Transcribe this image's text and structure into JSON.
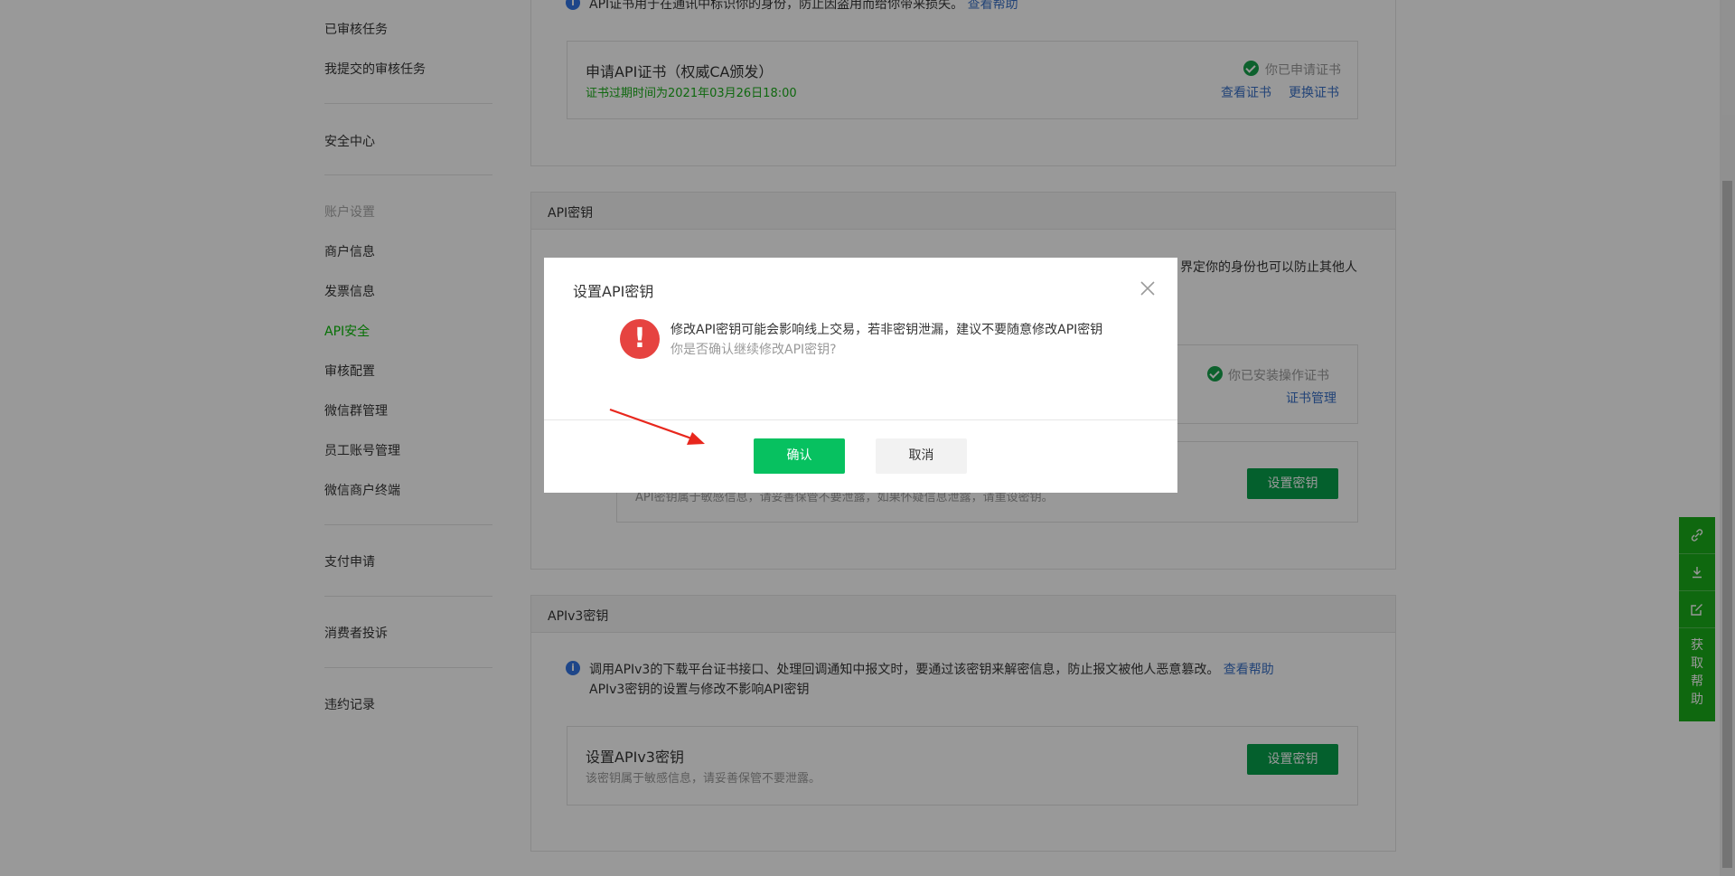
{
  "sidebar": {
    "items": [
      {
        "label": "已审核任务"
      },
      {
        "label": "我提交的审核任务"
      },
      {
        "label": "安全中心"
      },
      {
        "label": "账户设置"
      },
      {
        "label": "商户信息"
      },
      {
        "label": "发票信息"
      },
      {
        "label": "API安全"
      },
      {
        "label": "审核配置"
      },
      {
        "label": "微信群管理"
      },
      {
        "label": "员工账号管理"
      },
      {
        "label": "微信商户终端"
      },
      {
        "label": "支付申请"
      },
      {
        "label": "消费者投诉"
      },
      {
        "label": "违约记录"
      }
    ]
  },
  "cert_section": {
    "info_text": "API证书用于在通讯中标识你的身份，防止因盗用而给你带来损失。",
    "help_link": "查看帮助",
    "box_title": "申请API证书（权威CA颁发）",
    "expiry": "证书过期时间为2021年03月26日18:00",
    "status": "你已申请证书",
    "view_link": "查看证书",
    "replace_link": "更换证书"
  },
  "api_key_section": {
    "title": "API密钥",
    "info_text_tail": "界定你的身份也可以防止其他人",
    "op_status": "你已安装操作证书",
    "cert_manage_link": "证书管理",
    "set_button": "设置密钥",
    "note_obscured": "API密钥属于敏感信息，请妥善保管不要泄露，如果怀疑信息泄露，请重设密钥。"
  },
  "apiv3_section": {
    "title": "APIv3密钥",
    "info_line1": "调用APIv3的下载平台证书接口、处理回调通知中报文时，要通过该密钥来解密信息，防止报文被他人恶意篡改。",
    "help_link": "查看帮助",
    "info_line2": "APIv3密钥的设置与修改不影响API密钥",
    "box_title": "设置APIv3密钥",
    "box_sub": "该密钥属于敏感信息，请妥善保管不要泄露。",
    "set_button": "设置密钥"
  },
  "float_tools": {
    "icons": [
      "link-icon",
      "download-icon",
      "edit-icon"
    ],
    "help_label": [
      "获",
      "取",
      "帮",
      "助"
    ]
  },
  "modal": {
    "title": "设置API密钥",
    "message": "修改API密钥可能会影响线上交易，若非密钥泄漏，建议不要随意修改API密钥",
    "sub_message": "你是否确认继续修改API密钥?",
    "confirm_label": "确认",
    "cancel_label": "取消",
    "close_icon": "close-icon",
    "warning_icon": "warning-icon"
  },
  "colors": {
    "brand_green": "#07c160",
    "active_green": "#09bb07",
    "link_blue": "#3971c7",
    "warning_red": "#e64340",
    "arrow_red": "#e8271d"
  }
}
